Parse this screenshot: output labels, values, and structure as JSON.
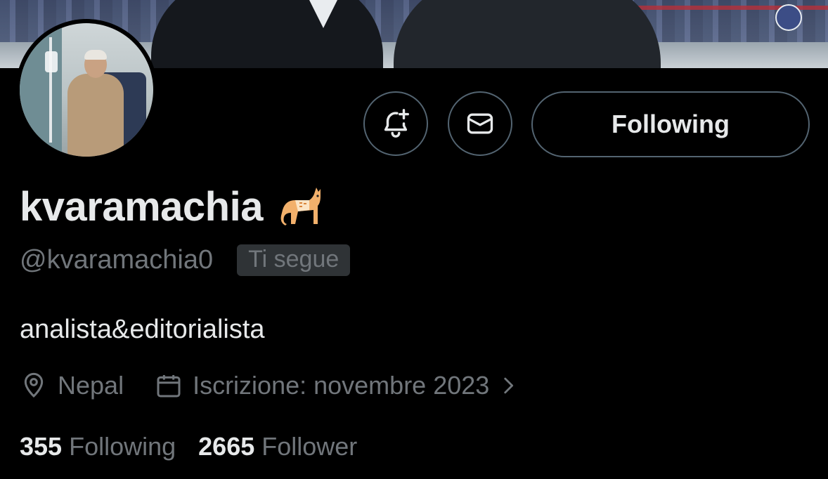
{
  "profile": {
    "display_name": "kvaramachia",
    "name_emoji": "🐈",
    "handle": "@kvaramachia0",
    "follows_you_badge": "Ti segue",
    "bio": "analista&editorialista",
    "location": "Nepal",
    "joined": "Iscrizione: novembre 2023",
    "following_count": "355",
    "following_label": "Following",
    "followers_count": "2665",
    "followers_label": "Follower"
  },
  "actions": {
    "notify_icon": "bell-plus-icon",
    "message_icon": "envelope-icon",
    "follow_button_label": "Following"
  },
  "icons": {
    "location": "map-pin-icon",
    "joined": "calendar-icon",
    "joined_more": "chevron-right-icon"
  },
  "colors": {
    "background": "#000000",
    "primary_text": "#e7e9ea",
    "secondary_text": "#71767b",
    "border": "#536471",
    "badge_bg": "#2f3336"
  }
}
